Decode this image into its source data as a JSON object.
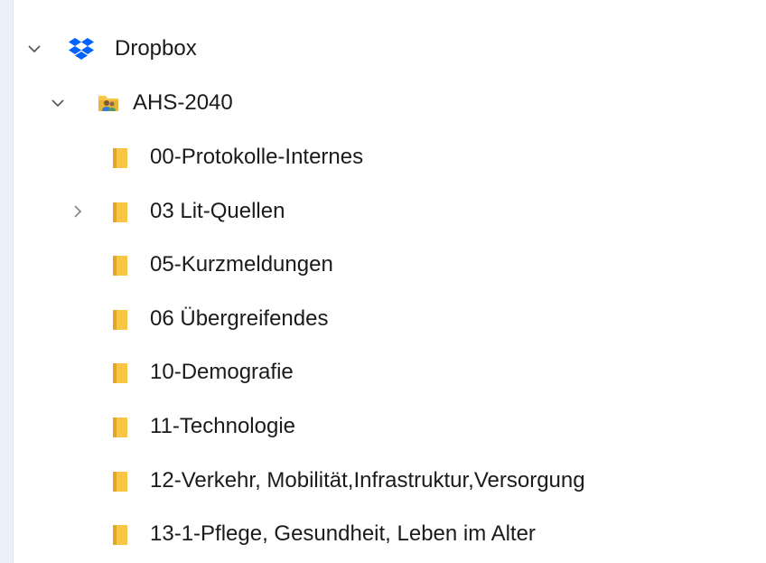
{
  "tree": {
    "root": {
      "label": "Dropbox",
      "icon": "dropbox-icon",
      "expanded": true
    },
    "shared_folder": {
      "label": "AHS-2040",
      "icon": "shared-folder-icon",
      "expanded": true
    },
    "folders": [
      {
        "label": "00-Protokolle-Internes",
        "icon": "folder-icon",
        "has_children": false
      },
      {
        "label": "03 Lit-Quellen",
        "icon": "folder-icon",
        "has_children": true,
        "expanded": false
      },
      {
        "label": "05-Kurzmeldungen",
        "icon": "folder-icon",
        "has_children": false
      },
      {
        "label": "06 Übergreifendes",
        "icon": "folder-icon",
        "has_children": false
      },
      {
        "label": "10-Demografie",
        "icon": "folder-icon",
        "has_children": false
      },
      {
        "label": "11-Technologie",
        "icon": "folder-icon",
        "has_children": false
      },
      {
        "label": "12-Verkehr, Mobilität,Infrastruktur,Versorgung",
        "icon": "folder-icon",
        "has_children": false
      },
      {
        "label": "13-1-Pflege, Gesundheit, Leben im Alter",
        "icon": "folder-icon",
        "has_children": false
      }
    ]
  },
  "colors": {
    "background": "#eaf1fb",
    "pane": "#ffffff",
    "folder": "#f8c545",
    "folder_shade": "#e0a826",
    "dropbox_blue": "#0061fe",
    "chevron": "#5c5c5c",
    "text": "#1b1b1b"
  }
}
